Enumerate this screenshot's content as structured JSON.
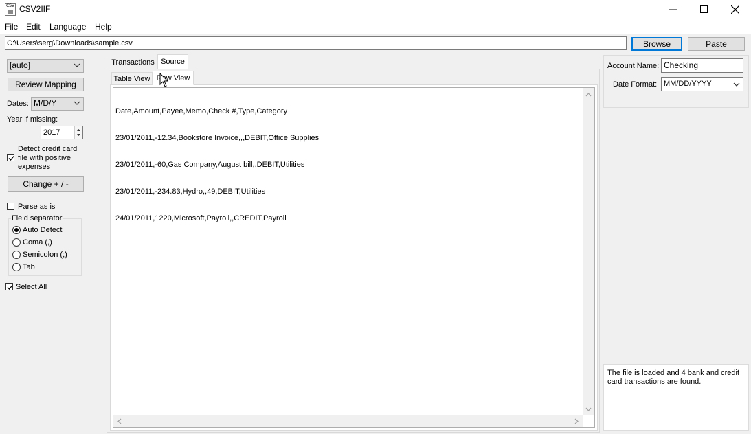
{
  "window": {
    "title": "CSV2IIF",
    "icon": "csv-file-icon",
    "icon_text": "CSV"
  },
  "menu": {
    "items": [
      "File",
      "Edit",
      "Language",
      "Help"
    ]
  },
  "path_row": {
    "file_path": "C:\\Users\\serg\\Downloads\\sample.csv",
    "browse_label": "Browse",
    "paste_label": "Paste"
  },
  "left_panel": {
    "format_combo": "[auto]",
    "review_mapping_label": "Review Mapping",
    "dates_label": "Dates:",
    "dates_value": "M/D/Y",
    "year_missing_label": "Year if missing:",
    "year_value": "2017",
    "detect_cc_label_lines": [
      "Detect credit card",
      "file with positive",
      "expenses"
    ],
    "detect_cc_checked": true,
    "change_sign_label": "Change + / -",
    "parse_as_is_label": "Parse as is",
    "parse_as_is_checked": false,
    "field_separator": {
      "title": "Field separator",
      "options": [
        "Auto Detect",
        "Coma (,)",
        "Semicolon (;)",
        "Tab"
      ],
      "selected": "Auto Detect"
    },
    "select_all_label": "Select All",
    "select_all_checked": true
  },
  "tabs": {
    "top": [
      "Transactions",
      "Source"
    ],
    "top_active": "Source",
    "sub": [
      "Table View",
      "Raw View"
    ],
    "sub_active": "Raw View"
  },
  "raw_view": {
    "lines": [
      "Date,Amount,Payee,Memo,Check #,Type,Category",
      "23/01/2011,-12.34,Bookstore Invoice,,,DEBIT,Office Supplies",
      "23/01/2011,-60,Gas Company,August bill,,DEBIT,Utilities",
      "23/01/2011,-234.83,Hydro,,49,DEBIT,Utilities",
      "24/01/2011,1220,Microsoft,Payroll,,CREDIT,Payroll"
    ]
  },
  "right_panel": {
    "account_name_label": "Account Name:",
    "account_name_value": "Checking",
    "date_format_label": "Date Format:",
    "date_format_value": "MM/DD/YYYY",
    "status_text": "The file is loaded and 4 bank and credit card transactions are found."
  }
}
